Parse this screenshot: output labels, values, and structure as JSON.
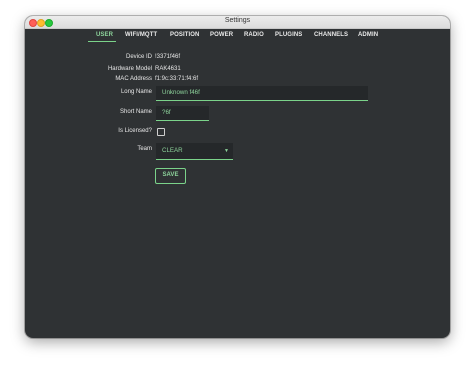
{
  "window": {
    "title": "Settings"
  },
  "tabs": [
    {
      "label": "USER",
      "active": true
    },
    {
      "label": "WIFI/MQTT"
    },
    {
      "label": "POSITION"
    },
    {
      "label": "POWER"
    },
    {
      "label": "RADIO"
    },
    {
      "label": "PLUGINS"
    },
    {
      "label": "CHANNELS"
    },
    {
      "label": "ADMIN"
    }
  ],
  "info": {
    "device_id_label": "Device ID",
    "device_id": "!3371f46f",
    "hw_model_label": "Hardware Model",
    "hw_model": "RAK4631",
    "mac_label": "MAC Address",
    "mac": "f1:9c:33:71:f4:6f"
  },
  "form": {
    "long_name_label": "Long Name",
    "long_name": "Unknown f46f",
    "short_name_label": "Short Name",
    "short_name": "?6f",
    "licensed_label": "Is Licensed?",
    "licensed": false,
    "team_label": "Team",
    "team": "CLEAR",
    "save_label": "SAVE"
  },
  "colors": {
    "accent": "#7bd38a",
    "background": "#2f3234",
    "field": "#25282a"
  }
}
